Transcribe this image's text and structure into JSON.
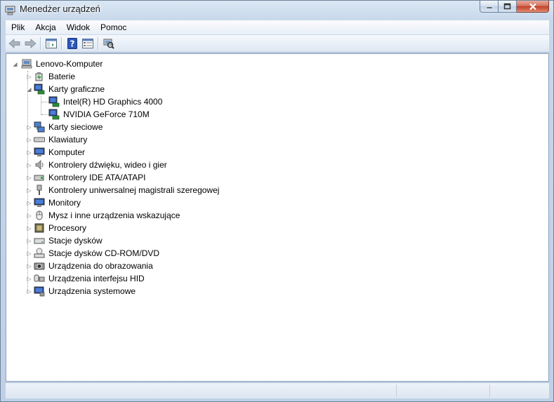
{
  "window": {
    "title": "Menedżer urządzeń",
    "icon": "device-manager-icon",
    "caption_buttons": [
      "minimize-icon",
      "maximize-icon",
      "close-icon"
    ]
  },
  "menubar": {
    "items": [
      "Plik",
      "Akcja",
      "Widok",
      "Pomoc"
    ]
  },
  "toolbar": {
    "buttons": [
      "back-arrow-icon",
      "forward-arrow-icon",
      "show-hide-console-tree-icon",
      "help-icon",
      "properties-icon",
      "scan-hardware-icon"
    ]
  },
  "tree": {
    "root": {
      "label": "Lenovo-Komputer",
      "icon": "computer-icon",
      "expanded": true
    },
    "items": [
      {
        "label": "Baterie",
        "icon": "battery-icon",
        "expanded": false,
        "level": 1
      },
      {
        "label": "Karty graficzne",
        "icon": "display-adapter-icon",
        "expanded": true,
        "level": 1
      },
      {
        "label": "Intel(R) HD Graphics 4000",
        "icon": "display-adapter-icon",
        "level": 2
      },
      {
        "label": "NVIDIA GeForce 710M",
        "icon": "display-adapter-icon",
        "level": 2
      },
      {
        "label": "Karty sieciowe",
        "icon": "network-adapter-icon",
        "expanded": false,
        "level": 1
      },
      {
        "label": "Klawiatury",
        "icon": "keyboard-icon",
        "expanded": false,
        "level": 1
      },
      {
        "label": "Komputer",
        "icon": "monitor-icon",
        "expanded": false,
        "level": 1
      },
      {
        "label": "Kontrolery dźwięku, wideo i gier",
        "icon": "speaker-icon",
        "expanded": false,
        "level": 1
      },
      {
        "label": "Kontrolery IDE ATA/ATAPI",
        "icon": "ide-controller-icon",
        "expanded": false,
        "level": 1
      },
      {
        "label": "Kontrolery uniwersalnej magistrali szeregowej",
        "icon": "usb-icon",
        "expanded": false,
        "level": 1
      },
      {
        "label": "Monitory",
        "icon": "monitor-icon",
        "expanded": false,
        "level": 1
      },
      {
        "label": "Mysz i inne urządzenia wskazujące",
        "icon": "mouse-icon",
        "expanded": false,
        "level": 1
      },
      {
        "label": "Procesory",
        "icon": "processor-icon",
        "expanded": false,
        "level": 1
      },
      {
        "label": "Stacje dysków",
        "icon": "disk-drive-icon",
        "expanded": false,
        "level": 1
      },
      {
        "label": "Stacje dysków CD-ROM/DVD",
        "icon": "cdrom-icon",
        "expanded": false,
        "level": 1
      },
      {
        "label": "Urządzenia do obrazowania",
        "icon": "camera-icon",
        "expanded": false,
        "level": 1
      },
      {
        "label": "Urządzenia interfejsu HID",
        "icon": "hid-icon",
        "expanded": false,
        "level": 1
      },
      {
        "label": "Urządzenia systemowe",
        "icon": "system-device-icon",
        "expanded": false,
        "level": 1
      }
    ]
  },
  "colors": {
    "frame": "#bed0e6",
    "close_button": "#c2432d",
    "help_icon": "#2b57b8"
  }
}
